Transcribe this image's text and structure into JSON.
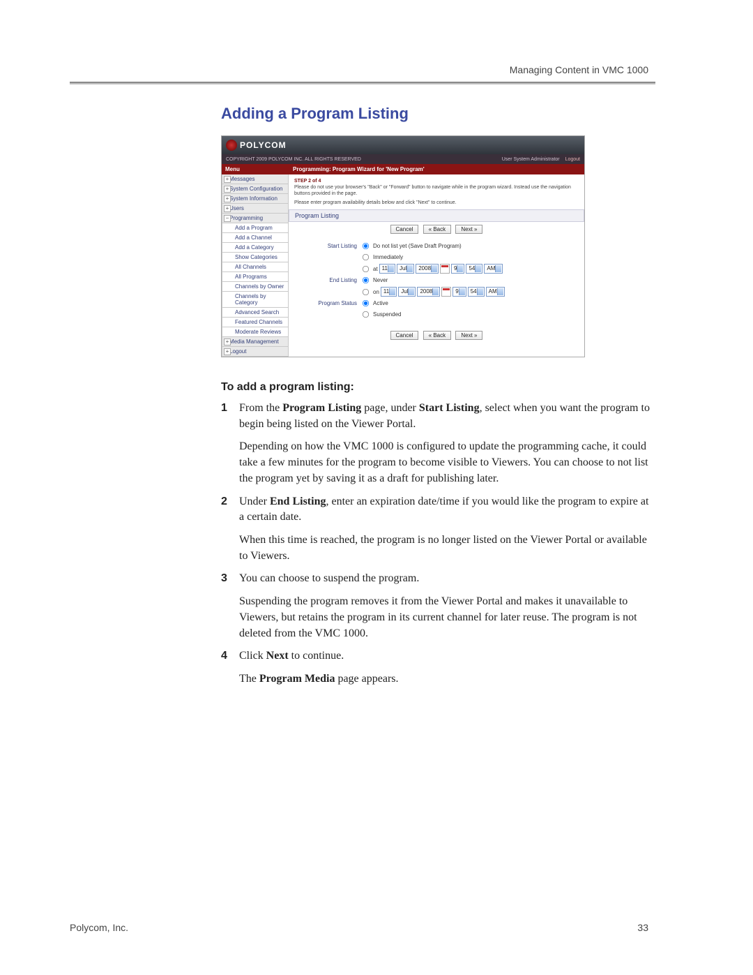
{
  "header": {
    "right": "Managing Content in VMC 1000"
  },
  "title": "Adding a Program Listing",
  "screenshot": {
    "brand": "POLYCOM",
    "copyright": "COPYRIGHT 2009 POLYCOM INC. ALL RIGHTS RESERVED",
    "user_label": "User",
    "user_name": "System Administrator",
    "logout": "Logout",
    "menu_header": "Menu",
    "menu": {
      "messages": "Messages",
      "system_config": "System Configuration",
      "system_info": "System Information",
      "users": "Users",
      "programming": "Programming",
      "programming_items": [
        "Add a Program",
        "Add a Channel",
        "Add a Category",
        "Show Categories",
        "All Channels",
        "All Programs",
        "Channels by Owner",
        "Channels by Category",
        "Advanced Search",
        "Featured Channels",
        "Moderate Reviews"
      ],
      "media_mgmt": "Media Management",
      "logout": "Logout"
    },
    "wizard": {
      "header": "Programming: Program Wizard for 'New Program'",
      "step": "STEP 2 of 4",
      "warning": "Please do not use your browser's \"Back\" or \"Forward\" button to navigate while in the program wizard. Instead use the navigation buttons provided in the page.",
      "instruction": "Please enter program availability details below and click \"Next\" to continue.",
      "section": "Program Listing",
      "buttons": {
        "cancel": "Cancel",
        "back": "« Back",
        "next": "Next »"
      },
      "start": {
        "label": "Start Listing",
        "opt_draft": "Do not list yet (Save Draft Program)",
        "opt_immediate": "Immediately",
        "opt_at": "at",
        "day": "11",
        "month": "Jul",
        "year": "2008",
        "hour": "9",
        "min": "54",
        "ampm": "AM"
      },
      "end": {
        "label": "End Listing",
        "opt_never": "Never",
        "opt_on": "on",
        "day": "11",
        "month": "Jul",
        "year": "2008",
        "hour": "9",
        "min": "54",
        "ampm": "AM"
      },
      "status": {
        "label": "Program Status",
        "opt_active": "Active",
        "opt_suspended": "Suspended"
      }
    }
  },
  "subhead": "To add a program listing:",
  "steps": [
    {
      "num": "1",
      "para1_pre": "From the ",
      "para1_b1": "Program Listing",
      "para1_mid": " page, under ",
      "para1_b2": "Start Listing",
      "para1_post": ", select when you want the program to begin being listed on the Viewer Portal.",
      "para2": "Depending on how the VMC 1000 is configured to update the programming cache, it could take a few minutes for the program to become visible to Viewers. You can choose to not list the program yet by saving it as a draft for publishing later."
    },
    {
      "num": "2",
      "para1_pre": "Under ",
      "para1_b1": "End Listing",
      "para1_post": ", enter an expiration date/time if you would like the program to expire at a certain date.",
      "para2": "When this time is reached, the program is no longer listed on the Viewer Portal or available to Viewers."
    },
    {
      "num": "3",
      "para1": "You can choose to suspend the program.",
      "para2": "Suspending the program removes it from the Viewer Portal and makes it unavailable to Viewers, but retains the program in its current channel for later reuse. The program is not deleted from the VMC 1000."
    },
    {
      "num": "4",
      "para1_pre": "Click ",
      "para1_b1": "Next",
      "para1_post": " to continue.",
      "para2_pre": "The ",
      "para2_b1": "Program Media",
      "para2_post": " page appears."
    }
  ],
  "footer": {
    "left": "Polycom, Inc.",
    "right": "33"
  }
}
